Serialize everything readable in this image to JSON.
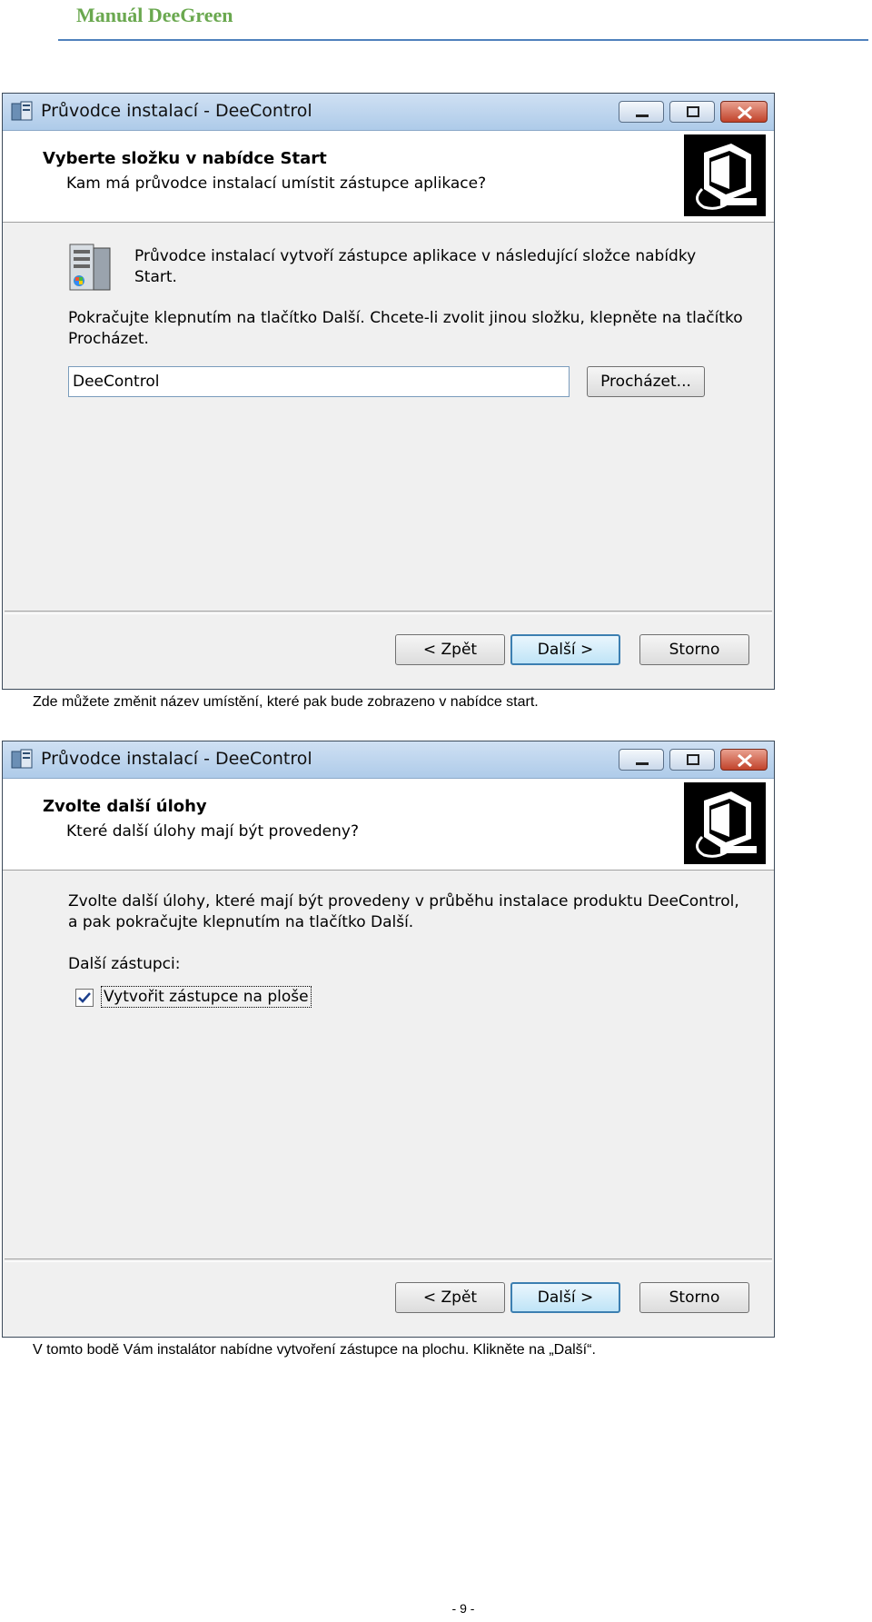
{
  "document": {
    "header": "Manuál DeeGreen",
    "page_number": "- 9 -"
  },
  "dialog1": {
    "title": "Průvodce instalací - DeeControl",
    "heading": "Vyberte složku v nabídce Start",
    "subheading": "Kam má průvodce instalací umístit zástupce aplikace?",
    "info_line1": "Průvodce instalací vytvoří zástupce aplikace v následující složce nabídky",
    "info_line2": "Start.",
    "instruction_line1": "Pokračujte klepnutím na tlačítko Další. Chcete-li zvolit jinou složku, klepněte na tlačítko",
    "instruction_line2": "Procházet.",
    "folder_value": "DeeControl",
    "browse_label": "Procházet...",
    "back_label": "< Zpět",
    "next_label": "Další >",
    "cancel_label": "Storno",
    "icons": [
      "setup-icon",
      "minimize-icon",
      "maximize-icon",
      "close-icon",
      "wizard-computer-icon",
      "start-menu-folder-icon"
    ]
  },
  "caption1": "Zde můžete změnit název umístění, které pak bude zobrazeno v nabídce start.",
  "dialog2": {
    "title": "Průvodce instalací - DeeControl",
    "heading": "Zvolte další úlohy",
    "subheading": "Které další úlohy mají být provedeny?",
    "info_line1": "Zvolte další úlohy, které mají být provedeny v průběhu instalace produktu DeeControl,",
    "info_line2": "a pak pokračujte klepnutím na tlačítko Další.",
    "group_label": "Další zástupci:",
    "checkbox_label": "Vytvořit zástupce na ploše",
    "checkbox_checked": true,
    "back_label": "< Zpět",
    "next_label": "Další >",
    "cancel_label": "Storno"
  },
  "caption2": "V tomto bodě Vám instalátor nabídne vytvoření zástupce na plochu. Klikněte na „Další“.",
  "colors": {
    "header_green": "#6aa84f",
    "rule_blue": "#4f81bd",
    "dialog_bg": "#f0f0f0",
    "titlebar": "#aecbe9",
    "default_button_border": "#3c7fb1",
    "close_button": "#c1432b"
  }
}
